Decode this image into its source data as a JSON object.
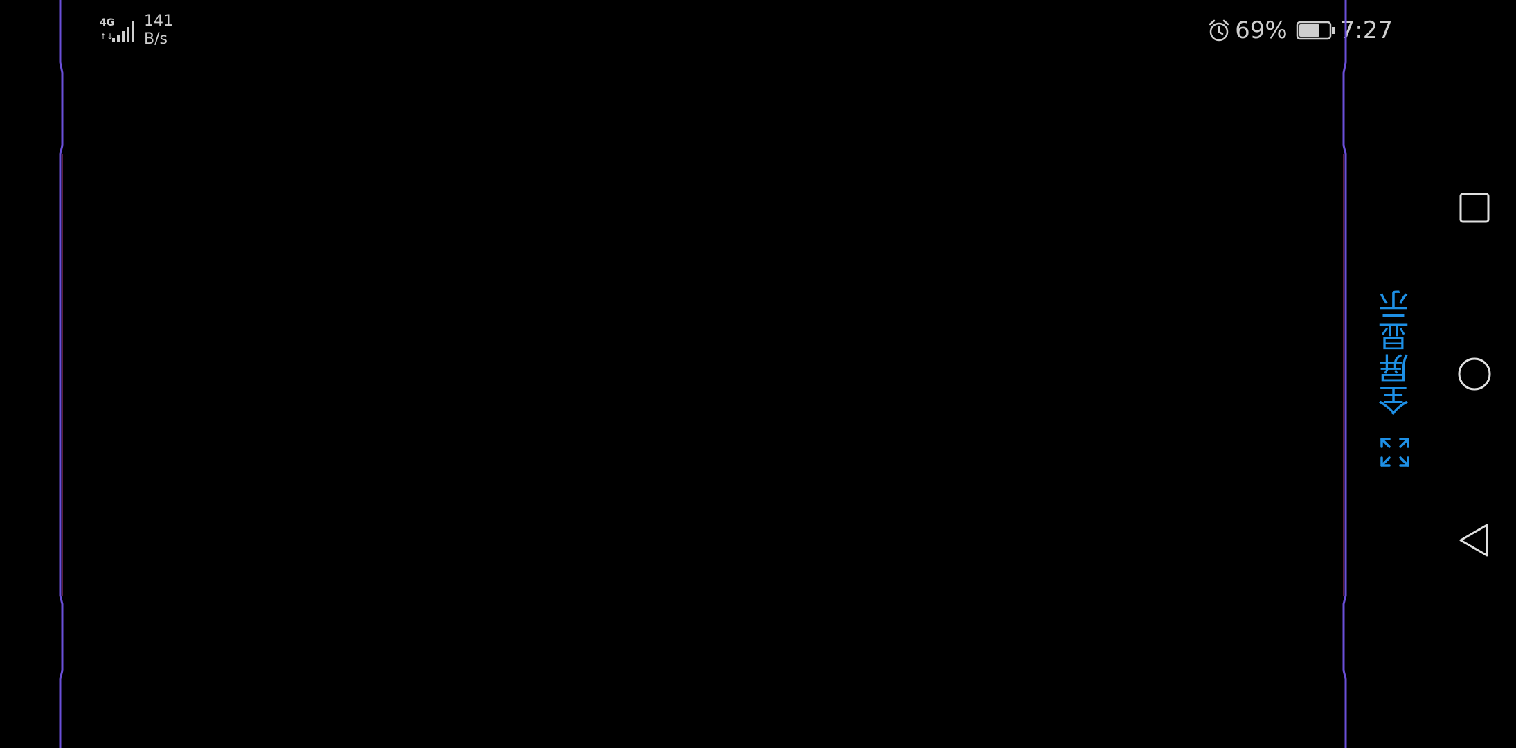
{
  "status_bar": {
    "network_type_icon": "4g-signal-icon",
    "net_speed_value": "141",
    "net_speed_unit": "B/s",
    "alarm_icon": "alarm-clock-icon",
    "battery_percent": "69%",
    "battery_level": 0.69,
    "battery_icon": "battery-icon",
    "time": "7:27"
  },
  "fullscreen": {
    "label": "全屏显示",
    "icon": "expand-icon",
    "color": "#1e90e6"
  },
  "navigation": {
    "recent_icon": "square-recents-icon",
    "home_icon": "circle-home-icon",
    "back_icon": "triangle-back-icon"
  },
  "colors": {
    "background": "#000000",
    "rail": "#6a4fd8",
    "status_text": "#cfcfcf"
  }
}
